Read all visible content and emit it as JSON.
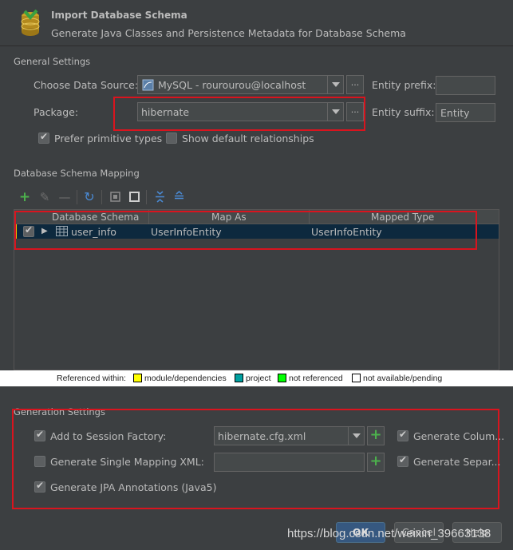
{
  "header": {
    "title": "Import Database Schema",
    "subtitle": "Generate Java Classes and Persistence Metadata for Database Schema",
    "icon": "database-icon"
  },
  "general": {
    "title": "General Settings",
    "data_source_label": "Choose Data Source:",
    "data_source_value": "MySQL - rourourou@localhost",
    "package_label": "Package:",
    "package_value": "hibernate",
    "entity_prefix_label": "Entity prefix:",
    "entity_prefix_value": "",
    "entity_suffix_label": "Entity suffix:",
    "entity_suffix_value": "Entity",
    "prefer_primitive_label": "Prefer primitive types",
    "prefer_primitive_checked": true,
    "show_default_rel_label": "Show default relationships",
    "show_default_rel_checked": false,
    "dots_label": "..."
  },
  "mapping": {
    "title": "Database Schema Mapping",
    "toolbar_icons": [
      "add-icon",
      "edit-icon",
      "remove-icon",
      "refresh-icon",
      "select-all-icon",
      "unselect-all-icon",
      "expand-all-icon",
      "collapse-all-icon"
    ],
    "columns": [
      "Database Schema",
      "Map As",
      "Mapped Type"
    ],
    "rows": [
      {
        "checked": true,
        "schema": "user_info",
        "map_as": "UserInfoEntity",
        "mapped_type": "UserInfoEntity"
      }
    ]
  },
  "legend": {
    "prefix": "Referenced within:",
    "items": [
      {
        "label": "module/dependencies",
        "color": "#ffff00"
      },
      {
        "label": "project",
        "color": "#00a0a0"
      },
      {
        "label": "not referenced",
        "color": "#00ff00"
      },
      {
        "label": "not available/pending",
        "color": "#ffffff"
      }
    ]
  },
  "generation": {
    "title": "Generation Settings",
    "add_session_label": "Add to Session Factory:",
    "add_session_checked": true,
    "session_value": "hibernate.cfg.xml",
    "single_mapping_label": "Generate Single Mapping XML:",
    "single_mapping_checked": false,
    "single_mapping_value": "",
    "jpa_label": "Generate JPA Annotations (Java5)",
    "jpa_checked": true,
    "gen_columns_label": "Generate Colum...",
    "gen_columns_checked": true,
    "gen_separate_label": "Generate Separ...",
    "gen_separate_checked": true,
    "plus_label": "+"
  },
  "buttons": {
    "ok": "OK",
    "cancel": "Cancel",
    "help": "Help"
  },
  "watermark": "https://blog.csdn.net/weixin_39663138",
  "colors": {
    "background": "#3c3f41",
    "selection": "#0d293e",
    "highlight_border": "#d9141e",
    "default_button": "#365880"
  }
}
